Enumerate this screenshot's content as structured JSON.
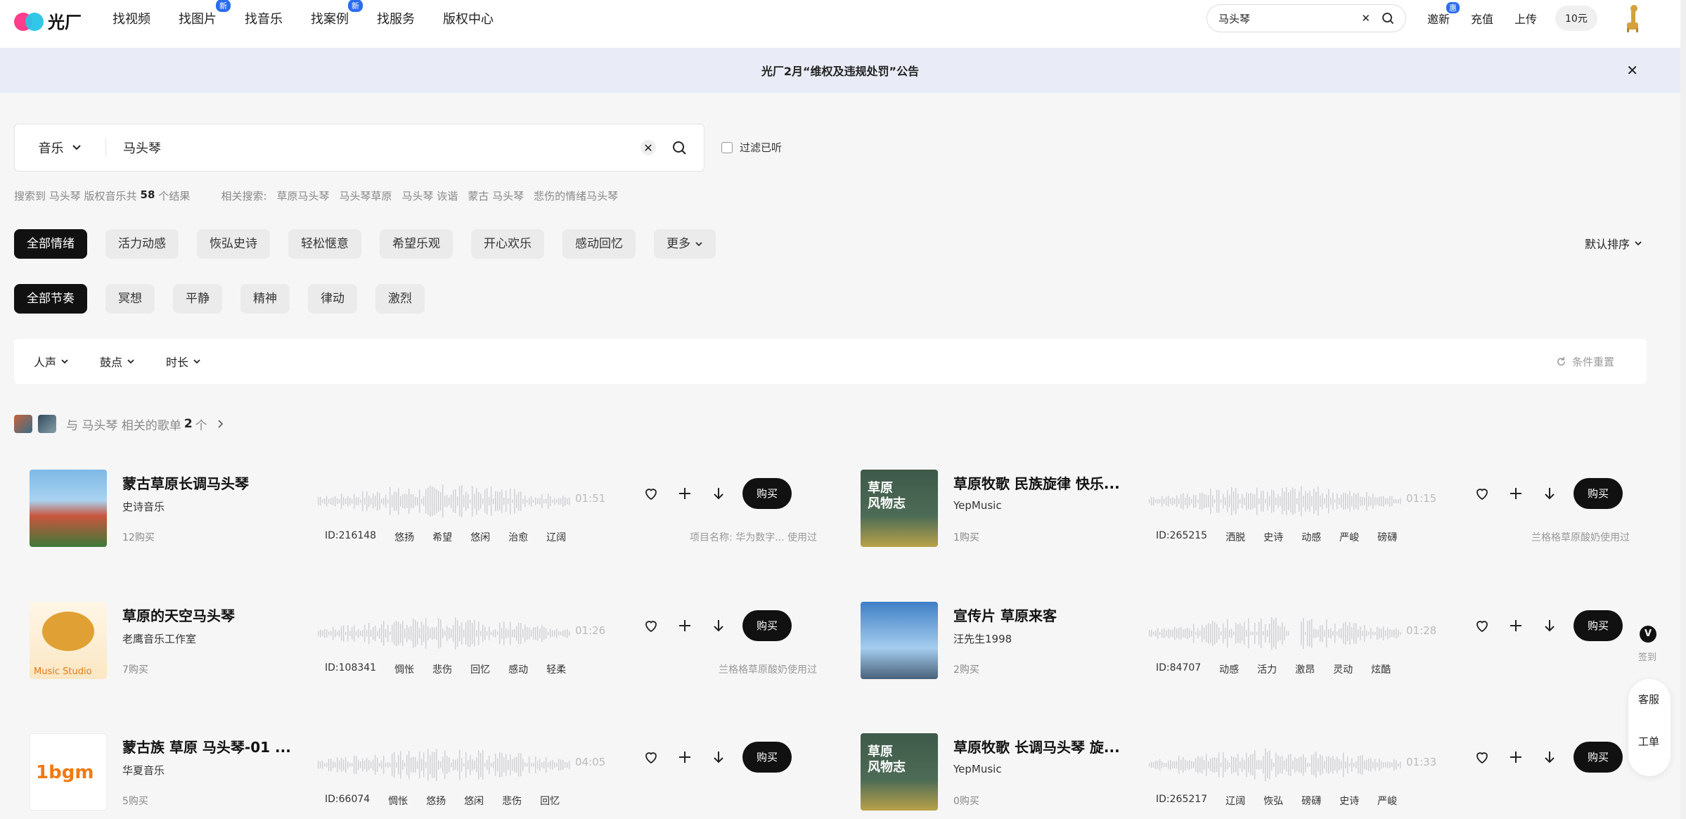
{
  "brand": {
    "name": "光厂"
  },
  "nav": [
    {
      "label": "找视频",
      "badge": ""
    },
    {
      "label": "找图片",
      "badge": "新"
    },
    {
      "label": "找音乐",
      "badge": ""
    },
    {
      "label": "找案例",
      "badge": "新"
    },
    {
      "label": "找服务",
      "badge": ""
    },
    {
      "label": "版权中心",
      "badge": ""
    }
  ],
  "top_search": {
    "value": "马头琴"
  },
  "top_right": {
    "invite": "邀新",
    "invite_badge": "惠",
    "recharge": "充值",
    "upload": "上传",
    "coin": "10元"
  },
  "announcement": {
    "text": "光厂2月“维权及违规处罚”公告"
  },
  "search": {
    "category": "音乐",
    "query": "马头琴"
  },
  "filter_heard": "过滤已听",
  "results": {
    "prefix": "搜索到 马头琴 版权音乐共",
    "count": "58",
    "suffix": "个结果",
    "related_label": "相关搜索:",
    "related": [
      "草原马头琴",
      "马头琴草原",
      "马头琴 诙谐",
      "蒙古 马头琴",
      "悲伤的情绪马头琴"
    ]
  },
  "mood_chips": [
    "全部情绪",
    "活力动感",
    "恢弘史诗",
    "轻松惬意",
    "希望乐观",
    "开心欢乐",
    "感动回忆",
    "更多"
  ],
  "tempo_chips": [
    "全部节奏",
    "冥想",
    "平静",
    "精神",
    "律动",
    "激烈"
  ],
  "sort": "默认排序",
  "filters": [
    "人声",
    "鼓点",
    "时长"
  ],
  "reset": "条件重置",
  "playlist": {
    "prefix": "与 马头琴 相关的歌单",
    "count": "2",
    "unit": "个"
  },
  "tracks": [
    {
      "title": "蒙古草原长调马头琴",
      "artist": "史诗音乐",
      "buys": "12购买",
      "duration": "01:51",
      "id": "ID:216148",
      "tags": [
        "悠扬",
        "希望",
        "悠闲",
        "治愈",
        "辽阔"
      ],
      "used": "项目名称: 华为数字... 使用过",
      "buy": "购买"
    },
    {
      "title": "草原牧歌 民族旋律 快乐...",
      "artist": "YepMusic",
      "buys": "1购买",
      "duration": "01:15",
      "id": "ID:265215",
      "tags": [
        "洒脱",
        "史诗",
        "动感",
        "严峻",
        "磅礴"
      ],
      "used": "兰格格草原酸奶使用过",
      "buy": "购买"
    },
    {
      "title": "草原的天空马头琴",
      "artist": "老鹰音乐工作室",
      "buys": "7购买",
      "duration": "01:26",
      "id": "ID:108341",
      "tags": [
        "惆怅",
        "悲伤",
        "回忆",
        "感动",
        "轻柔"
      ],
      "used": "兰格格草原酸奶使用过",
      "buy": "购买"
    },
    {
      "title": "宣传片 草原来客",
      "artist": "汪先生1998",
      "buys": "2购买",
      "duration": "01:28",
      "id": "ID:84707",
      "tags": [
        "动感",
        "活力",
        "激昂",
        "灵动",
        "炫酷"
      ],
      "used": "",
      "buy": "购买"
    },
    {
      "title": "蒙古族 草原 马头琴-01 ...",
      "artist": "华夏音乐",
      "buys": "5购买",
      "duration": "04:05",
      "id": "ID:66074",
      "tags": [
        "惆怅",
        "悠扬",
        "悠闲",
        "悲伤",
        "回忆"
      ],
      "used": "",
      "buy": "购买"
    },
    {
      "title": "草原牧歌 长调马头琴 旋...",
      "artist": "YepMusic",
      "buys": "0购买",
      "duration": "01:33",
      "id": "ID:265217",
      "tags": [
        "辽阔",
        "恢弘",
        "磅礴",
        "史诗",
        "严峻"
      ],
      "used": "",
      "buy": "购买"
    }
  ],
  "covers": {
    "c2_line1": "草原",
    "c2_line2": "风物志",
    "c3_text": "Music Studio",
    "c5_text": "1bgm"
  },
  "side": {
    "v": "V",
    "sign": "签到",
    "service": "客服",
    "ticket": "工单"
  }
}
